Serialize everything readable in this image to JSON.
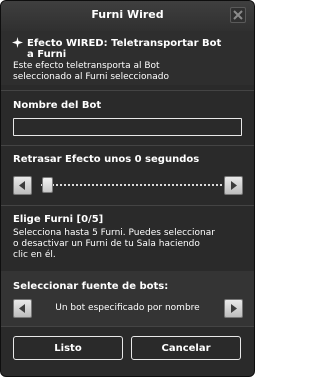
{
  "window": {
    "title": "Furni Wired"
  },
  "effect": {
    "heading_line1": "Efecto WIRED: Teletransportar Bot",
    "heading_line2": "a Furni",
    "description_line1": "Este efecto teletransporta al Bot",
    "description_line2": "seleccionado al Furni seleccionado"
  },
  "bot_name": {
    "label": "Nombre del Bot",
    "value": ""
  },
  "delay": {
    "label": "Retrasar Efecto unos 0 segundos",
    "value_seconds": 0
  },
  "furni": {
    "label": "Elige Furni [0/5]",
    "help_line1": "Selecciona hasta 5 Furni. Puedes seleccionar",
    "help_line2": "o desactivar un Furni de tu Sala haciendo",
    "help_line3": "clic en él."
  },
  "bot_source": {
    "label": "Seleccionar fuente de bots:",
    "value": "Un bot especificado por nombre"
  },
  "buttons": {
    "ok": "Listo",
    "cancel": "Cancelar"
  },
  "icons": {
    "close": "close-icon",
    "effect": "bolt-icon",
    "left": "arrow-left-icon",
    "right": "arrow-right-icon"
  }
}
